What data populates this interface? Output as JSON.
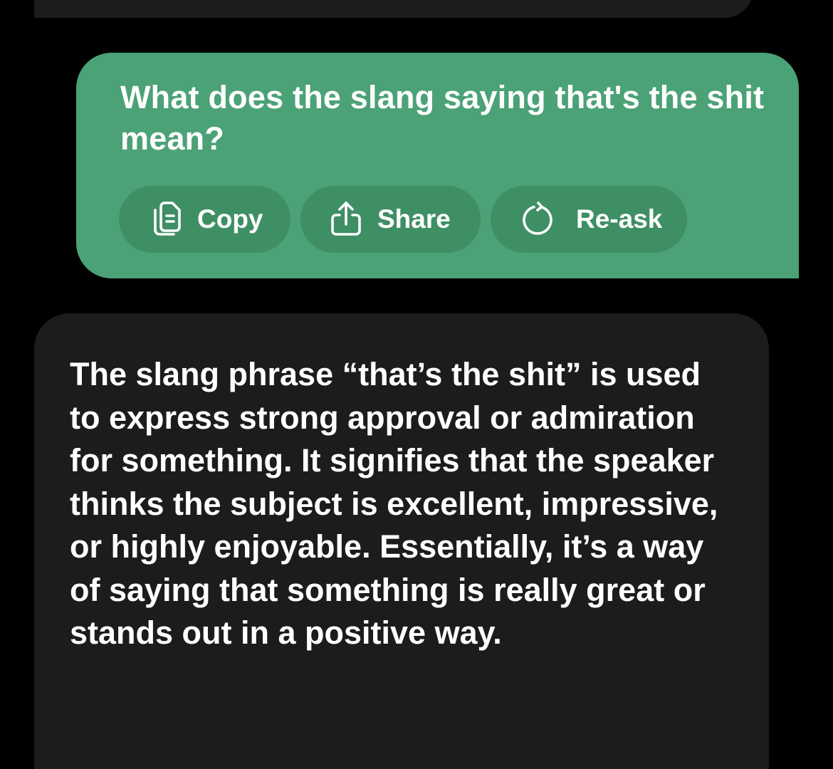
{
  "user_message": {
    "text": "What does the slang saying that's the shit mean?"
  },
  "actions": [
    {
      "label": "Copy",
      "icon": "copy-icon"
    },
    {
      "label": "Share",
      "icon": "share-icon"
    },
    {
      "label": "Re-ask",
      "icon": "refresh-icon"
    }
  ],
  "assistant_message": {
    "text": "The slang phrase “that’s the shit” is used to express strong approval or admiration for something. It signifies that the speaker thinks the subject is excellent, impressive, or highly enjoyable. Essentially, it’s a way of saying that something is really great or stands out in a positive way."
  },
  "colors": {
    "background": "#000000",
    "user_bubble": "#4ba276",
    "action_button": "#3f8f64",
    "assistant_bubble": "#1c1c1e",
    "text": "#ffffff"
  }
}
